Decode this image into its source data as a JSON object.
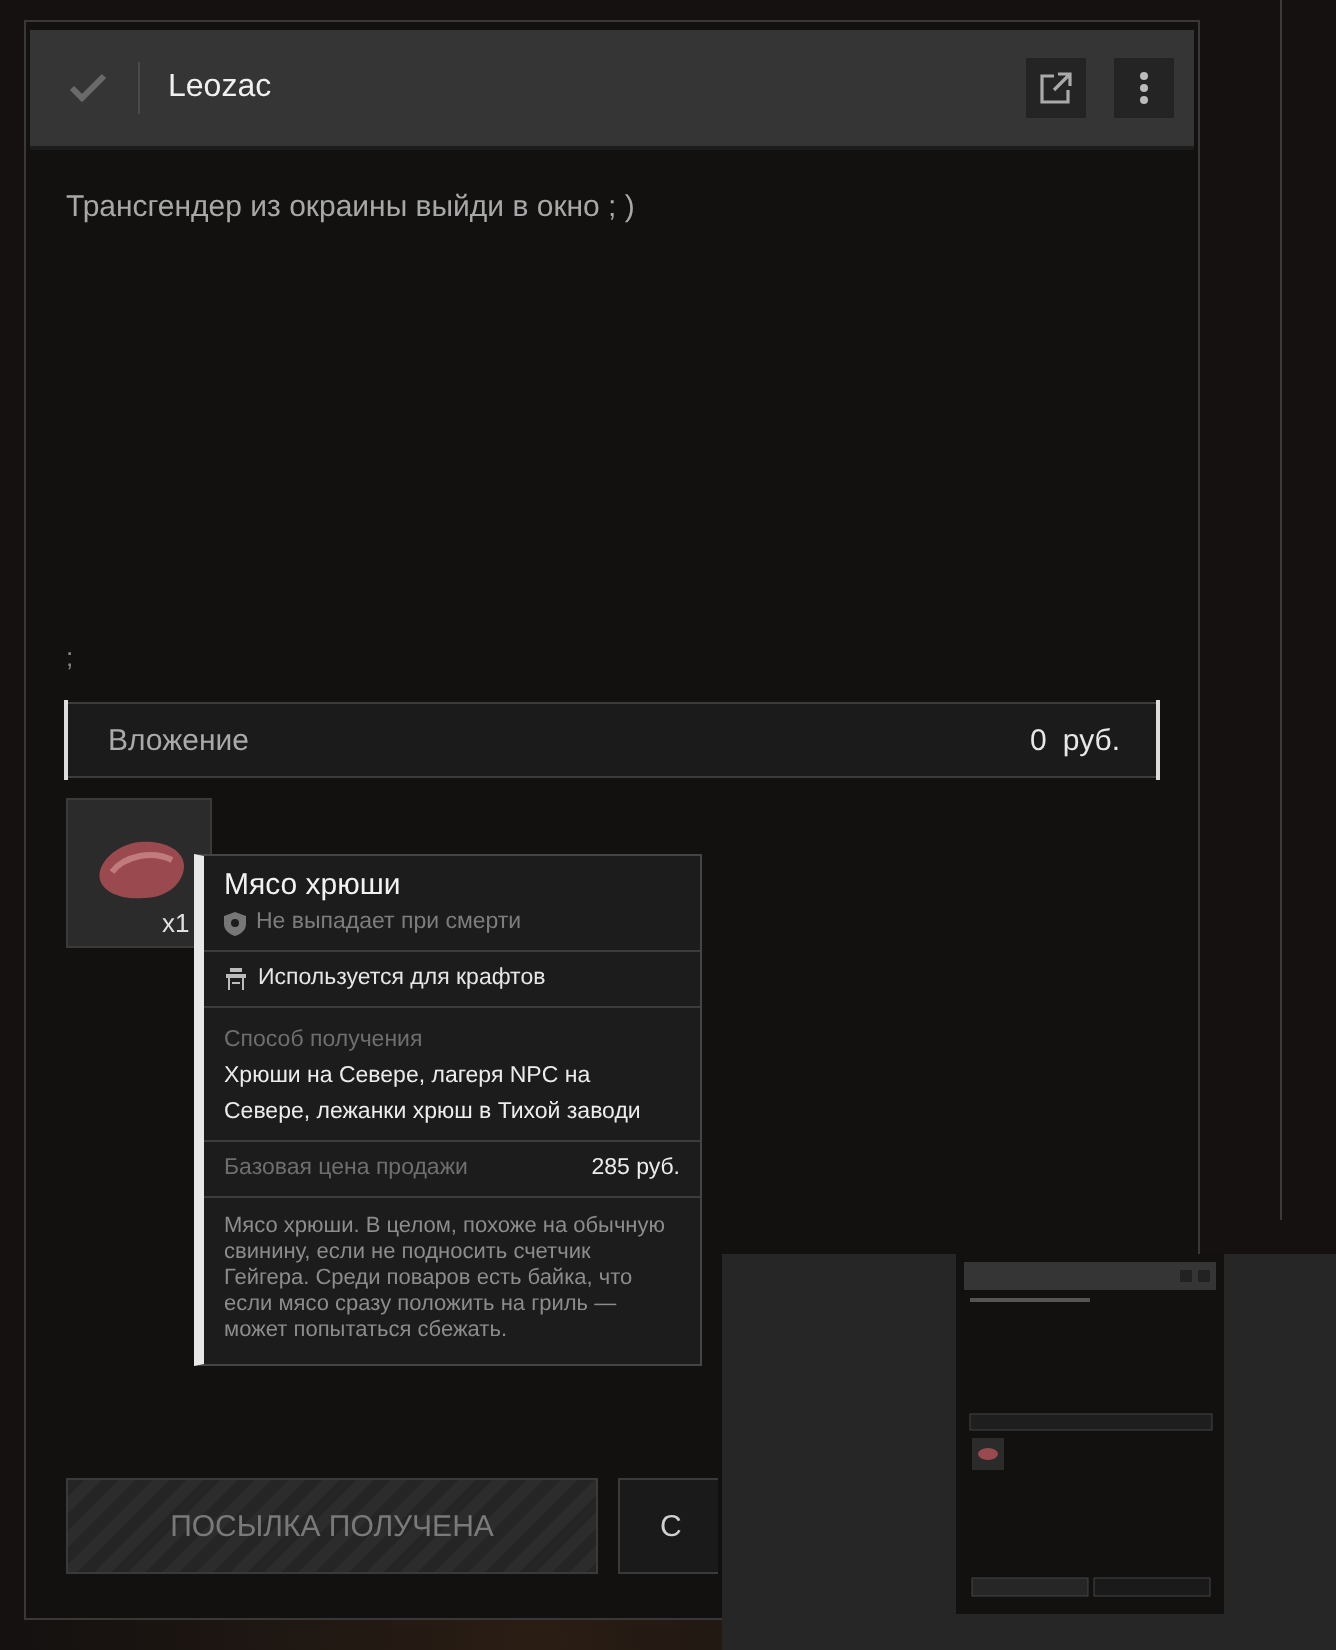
{
  "header": {
    "checked": false,
    "title": "Leozac"
  },
  "message": {
    "body": "Трансгендер из окраины выйди в окно ; )",
    "signature": ";"
  },
  "attachment": {
    "label": "Вложение",
    "amount": "0",
    "currency": "руб."
  },
  "item": {
    "count": "x1"
  },
  "tooltip": {
    "title": "Мясо хрюши",
    "tag": "Не выпадает при смерти",
    "craft": "Используется для крафтов",
    "source_label": "Способ получения",
    "source": "Хрюши на Севере, лагеря NPC на Севере, лежанки хрюш в Тихой заводи",
    "price_label": "Базовая цена продажи",
    "price": "285 руб.",
    "description": "Мясо хрюши. В целом, похоже на обычную свинину, если не подносить счетчик Гейгера. Среди поваров есть байка, что если мясо сразу положить на гриль — может попытаться сбежать."
  },
  "buttons": [
    {
      "label": "ПОСЫЛКА ПОЛУЧЕНА",
      "disabled": true
    },
    {
      "label": "С",
      "disabled": false
    }
  ]
}
